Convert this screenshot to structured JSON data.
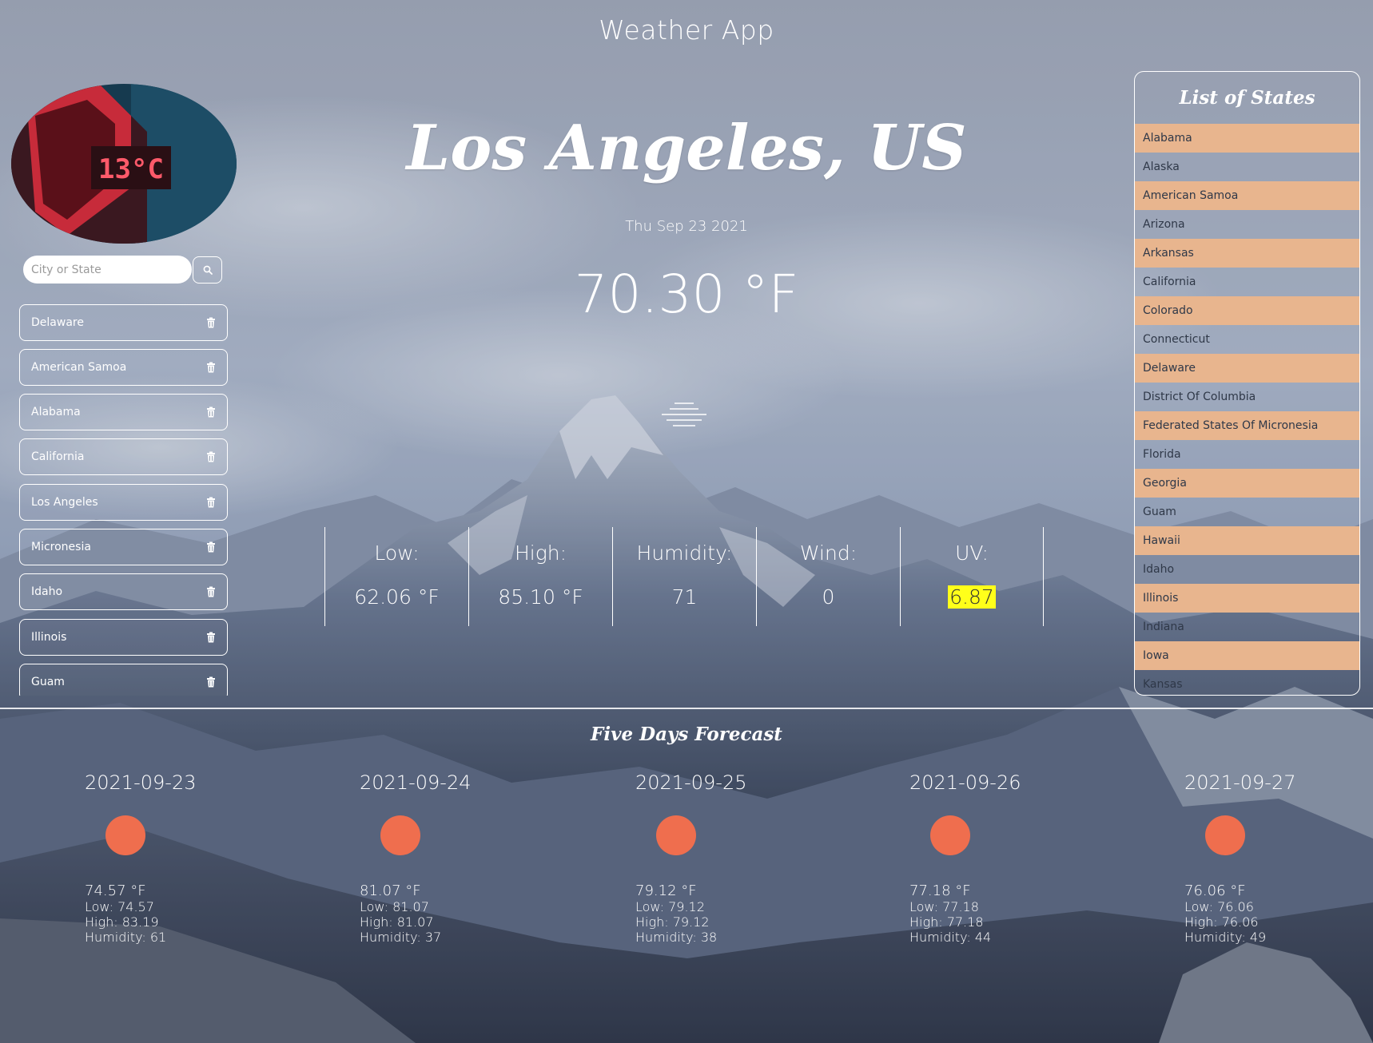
{
  "header": {
    "title": "Weather App"
  },
  "logo": {
    "display_text": "13°C"
  },
  "search": {
    "placeholder": "City or State",
    "button_icon": "search-icon"
  },
  "history": [
    {
      "label": "Delaware"
    },
    {
      "label": "American Samoa"
    },
    {
      "label": "Alabama"
    },
    {
      "label": "California"
    },
    {
      "label": "Los Angeles"
    },
    {
      "label": "Micronesia"
    },
    {
      "label": "Idaho"
    },
    {
      "label": "Illinois"
    },
    {
      "label": "Guam"
    }
  ],
  "current": {
    "city": "Los Angeles, US",
    "date": "Thu Sep 23 2021",
    "temp": "70.30 °F",
    "icon": "haze-icon",
    "stats": [
      {
        "label": "Low:",
        "value": "62.06 °F"
      },
      {
        "label": "High:",
        "value": "85.10 °F"
      },
      {
        "label": "Humidity:",
        "value": "71"
      },
      {
        "label": "Wind:",
        "value": "0"
      },
      {
        "label": "UV:",
        "value": "6.87"
      }
    ]
  },
  "states_panel": {
    "title": "List of States",
    "items": [
      "Alabama",
      "Alaska",
      "American Samoa",
      "Arizona",
      "Arkansas",
      "California",
      "Colorado",
      "Connecticut",
      "Delaware",
      "District Of Columbia",
      "Federated States Of Micronesia",
      "Florida",
      "Georgia",
      "Guam",
      "Hawaii",
      "Idaho",
      "Illinois",
      "Indiana",
      "Iowa",
      "Kansas"
    ]
  },
  "forecast": {
    "title": "Five Days Forecast",
    "days": [
      {
        "date": "2021-09-23",
        "temp": "74.57 °F",
        "low": "Low: 74.57",
        "high": "High: 83.19",
        "humidity": "Humidity: 61"
      },
      {
        "date": "2021-09-24",
        "temp": "81.07 °F",
        "low": "Low: 81.07",
        "high": "High: 81.07",
        "humidity": "Humidity: 37"
      },
      {
        "date": "2021-09-25",
        "temp": "79.12 °F",
        "low": "Low: 79.12",
        "high": "High: 79.12",
        "humidity": "Humidity: 38"
      },
      {
        "date": "2021-09-26",
        "temp": "77.18 °F",
        "low": "Low: 77.18",
        "high": "High: 77.18",
        "humidity": "Humidity: 44"
      },
      {
        "date": "2021-09-27",
        "temp": "76.06 °F",
        "low": "Low: 76.06",
        "high": "High: 76.06",
        "humidity": "Humidity: 49"
      }
    ]
  },
  "colors": {
    "state_row_highlight": "#e8b58e",
    "forecast_icon": "#ef6e4e",
    "uv_highlight": "#ffff1a"
  }
}
